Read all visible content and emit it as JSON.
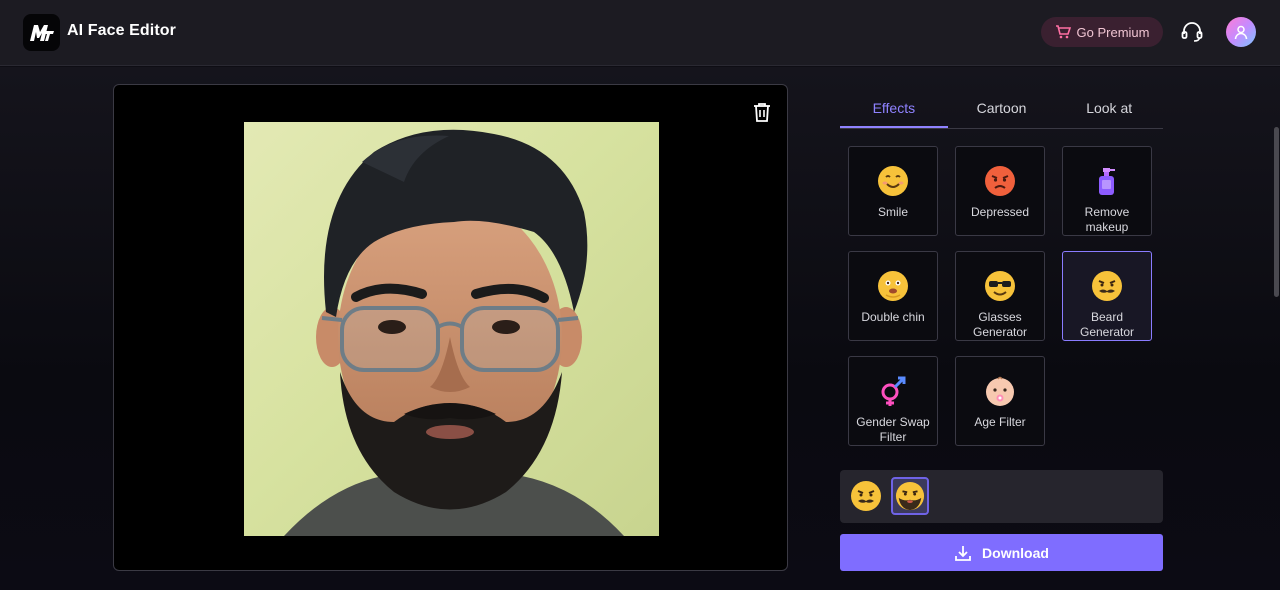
{
  "app": {
    "title": "AI Face Editor"
  },
  "header": {
    "premium_label": "Go Premium"
  },
  "tabs": [
    {
      "label": "Effects",
      "active": true
    },
    {
      "label": "Cartoon",
      "active": false
    },
    {
      "label": "Look at",
      "active": false
    }
  ],
  "effects": [
    {
      "label": "Smile",
      "icon": "smile-emoji-icon"
    },
    {
      "label": "Depressed",
      "icon": "angry-emoji-icon"
    },
    {
      "label": "Remove makeup",
      "icon": "makeup-bottle-icon"
    },
    {
      "label": "Double chin",
      "icon": "double-chin-emoji-icon"
    },
    {
      "label": "Glasses Generator",
      "icon": "sunglasses-emoji-icon"
    },
    {
      "label": "Beard Generator",
      "icon": "beard-emoji-icon",
      "selected": true
    },
    {
      "label": "Gender Swap Filter",
      "icon": "gender-symbol-icon"
    },
    {
      "label": "Age Filter",
      "icon": "baby-face-icon"
    }
  ],
  "history": [
    {
      "icon": "beard-emoji-icon",
      "active": false
    },
    {
      "icon": "beard-result-icon",
      "active": true
    }
  ],
  "download": {
    "label": "Download"
  },
  "colors": {
    "accent": "#7f6dff",
    "tab_active": "#8f82ff",
    "premium_bg": "#3a2030"
  }
}
